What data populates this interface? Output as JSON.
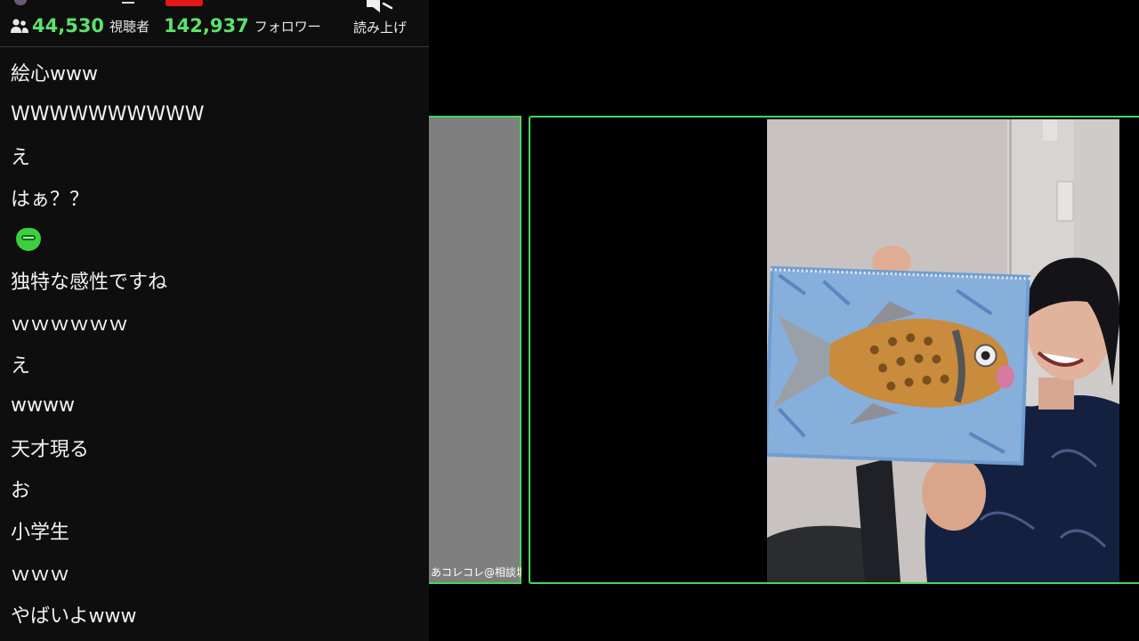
{
  "header": {
    "viewer_count": "44,530",
    "viewer_label": "視聴者",
    "follower_count": "142,937",
    "follower_label": "フォロワー",
    "read_aloud_label": "読み上げ"
  },
  "chat": {
    "messages": [
      "絵心www",
      "WWWWWWWWWW",
      "え",
      "はぁ？？",
      "",
      "独特な感性ですね",
      "ｗｗｗｗｗｗ",
      "え",
      "wwww",
      "天才現る",
      "お",
      "小学生",
      "ｗｗｗ",
      "やばいよwww"
    ],
    "stamp_icon": "green-smile-stamp-icon"
  },
  "video": {
    "left_tile_name": "あコレコレ@相談垢"
  },
  "colors": {
    "accent_green": "#5de26a",
    "tile_border": "#4ad45a",
    "live_red": "#e01818"
  }
}
